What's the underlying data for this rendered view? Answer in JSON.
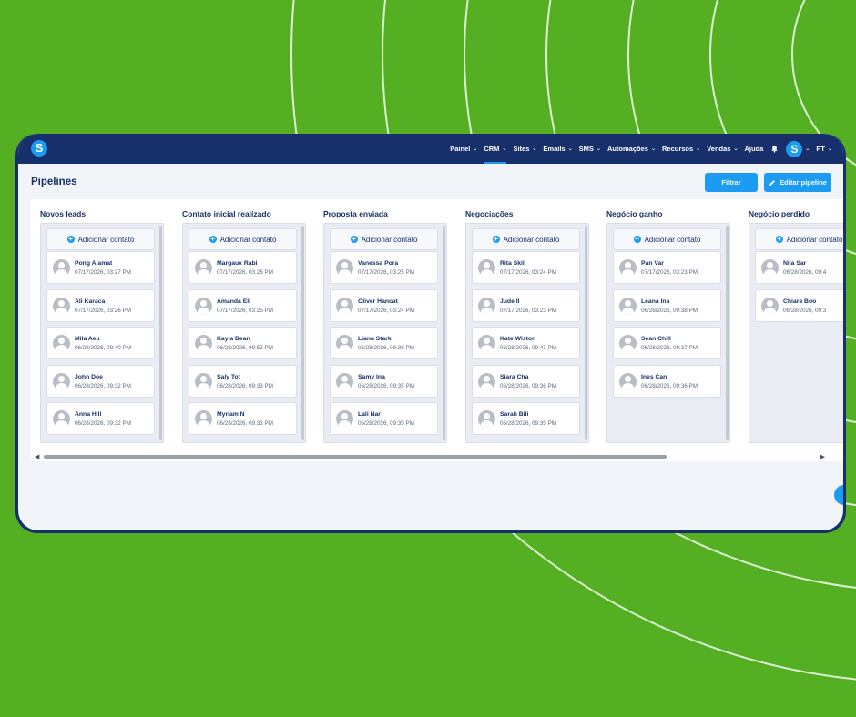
{
  "brand": {
    "logo_letter": "S",
    "accent": "#1b9cf2",
    "navy": "#17306b",
    "background": "#54b022"
  },
  "nav": {
    "items": [
      {
        "label": "Painel",
        "chevron": true
      },
      {
        "label": "CRM",
        "chevron": true,
        "active": true
      },
      {
        "label": "Sites",
        "chevron": true
      },
      {
        "label": "Emails",
        "chevron": true
      },
      {
        "label": "SMS",
        "chevron": true
      },
      {
        "label": "Automações",
        "chevron": true
      },
      {
        "label": "Recursos",
        "chevron": true
      },
      {
        "label": "Vendas",
        "chevron": true
      },
      {
        "label": "Ajuda",
        "chevron": false
      }
    ],
    "avatar_letter": "S",
    "language": "PT"
  },
  "page": {
    "title": "Pipelines",
    "filter_label": "Filtrar",
    "edit_label": "Editar pipeline"
  },
  "add_contact_label": "Adicionar contato",
  "columns": [
    {
      "title": "Novos leads",
      "cards": [
        {
          "name": "Pong Alamat",
          "date": "07/17/2026, 03:27 PM"
        },
        {
          "name": "Ali Karaca",
          "date": "07/17/2026, 03:26 PM"
        },
        {
          "name": "Mila Aeu",
          "date": "06/28/2026, 09:40 PM"
        },
        {
          "name": "John Doe",
          "date": "06/28/2026, 09:32 PM"
        },
        {
          "name": "Anna Hill",
          "date": "06/28/2026, 09:32 PM"
        }
      ]
    },
    {
      "title": "Contato inicial realizado",
      "cards": [
        {
          "name": "Margaux Rabi",
          "date": "07/17/2026, 03:26 PM"
        },
        {
          "name": "Amanda Eli",
          "date": "07/17/2026, 03:25 PM"
        },
        {
          "name": "Kayla Bean",
          "date": "06/28/2026, 09:52 PM"
        },
        {
          "name": "Saly Tot",
          "date": "06/28/2026, 09:33 PM"
        },
        {
          "name": "Myriam N",
          "date": "06/28/2026, 09:33 PM"
        }
      ]
    },
    {
      "title": "Proposta enviada",
      "cards": [
        {
          "name": "Vanessa Pora",
          "date": "07/17/2026, 03:25 PM"
        },
        {
          "name": "Oliver Hancat",
          "date": "07/17/2026, 03:24 PM"
        },
        {
          "name": "Liana Stark",
          "date": "06/28/2026, 09:39 PM"
        },
        {
          "name": "Samy Ina",
          "date": "06/28/2026, 09:35 PM"
        },
        {
          "name": "Lali Nar",
          "date": "06/28/2026, 09:35 PM"
        }
      ]
    },
    {
      "title": "Negociações",
      "cards": [
        {
          "name": "Rita Skil",
          "date": "07/17/2026, 03:24 PM"
        },
        {
          "name": "Jude II",
          "date": "07/17/2026, 03:23 PM"
        },
        {
          "name": "Kate Wiston",
          "date": "06/28/2026, 09:41 PM"
        },
        {
          "name": "Siara Cha",
          "date": "06/28/2026, 09:36 PM"
        },
        {
          "name": "Sarah Bili",
          "date": "06/28/2026, 09:35 PM"
        }
      ]
    },
    {
      "title": "Negócio ganho",
      "cards": [
        {
          "name": "Pan Var",
          "date": "07/17/2026, 03:23 PM"
        },
        {
          "name": "Leana Ina",
          "date": "06/28/2026, 09:38 PM"
        },
        {
          "name": "Sean Chill",
          "date": "06/28/2026, 09:37 PM"
        },
        {
          "name": "Ines Can",
          "date": "06/28/2026, 09:36 PM"
        }
      ]
    },
    {
      "title": "Negócio perdido",
      "cards": [
        {
          "name": "Nila Sar",
          "date": "06/28/2026, 09:4"
        },
        {
          "name": "Chiara Boo",
          "date": "06/28/2026, 09:3"
        }
      ]
    }
  ]
}
